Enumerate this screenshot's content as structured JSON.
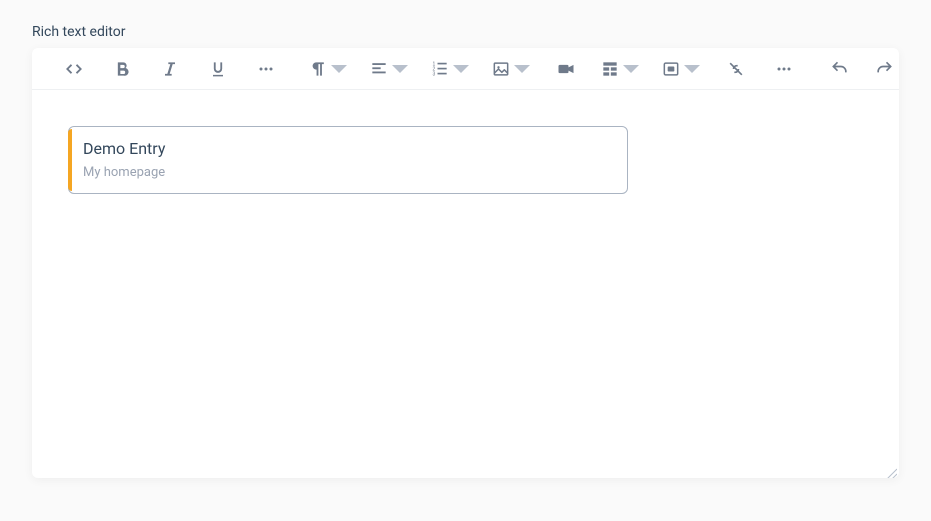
{
  "label": "Rich text editor",
  "entry": {
    "title": "Demo Entry",
    "subtitle": "My homepage"
  },
  "toolbar": {
    "icons": {
      "code": "code-icon",
      "bold": "bold-icon",
      "italic": "italic-icon",
      "underline": "underline-icon",
      "more_text": "ellipsis-icon",
      "paragraph": "pilcrow-icon",
      "align": "align-left-icon",
      "list": "ordered-list-icon",
      "image": "image-icon",
      "video": "video-icon",
      "table": "table-icon",
      "embed": "embed-square-icon",
      "link": "link-slash-icon",
      "more_rich": "ellipsis-icon",
      "undo": "undo-icon",
      "redo": "redo-icon",
      "fullscreen": "fullscreen-icon"
    }
  }
}
